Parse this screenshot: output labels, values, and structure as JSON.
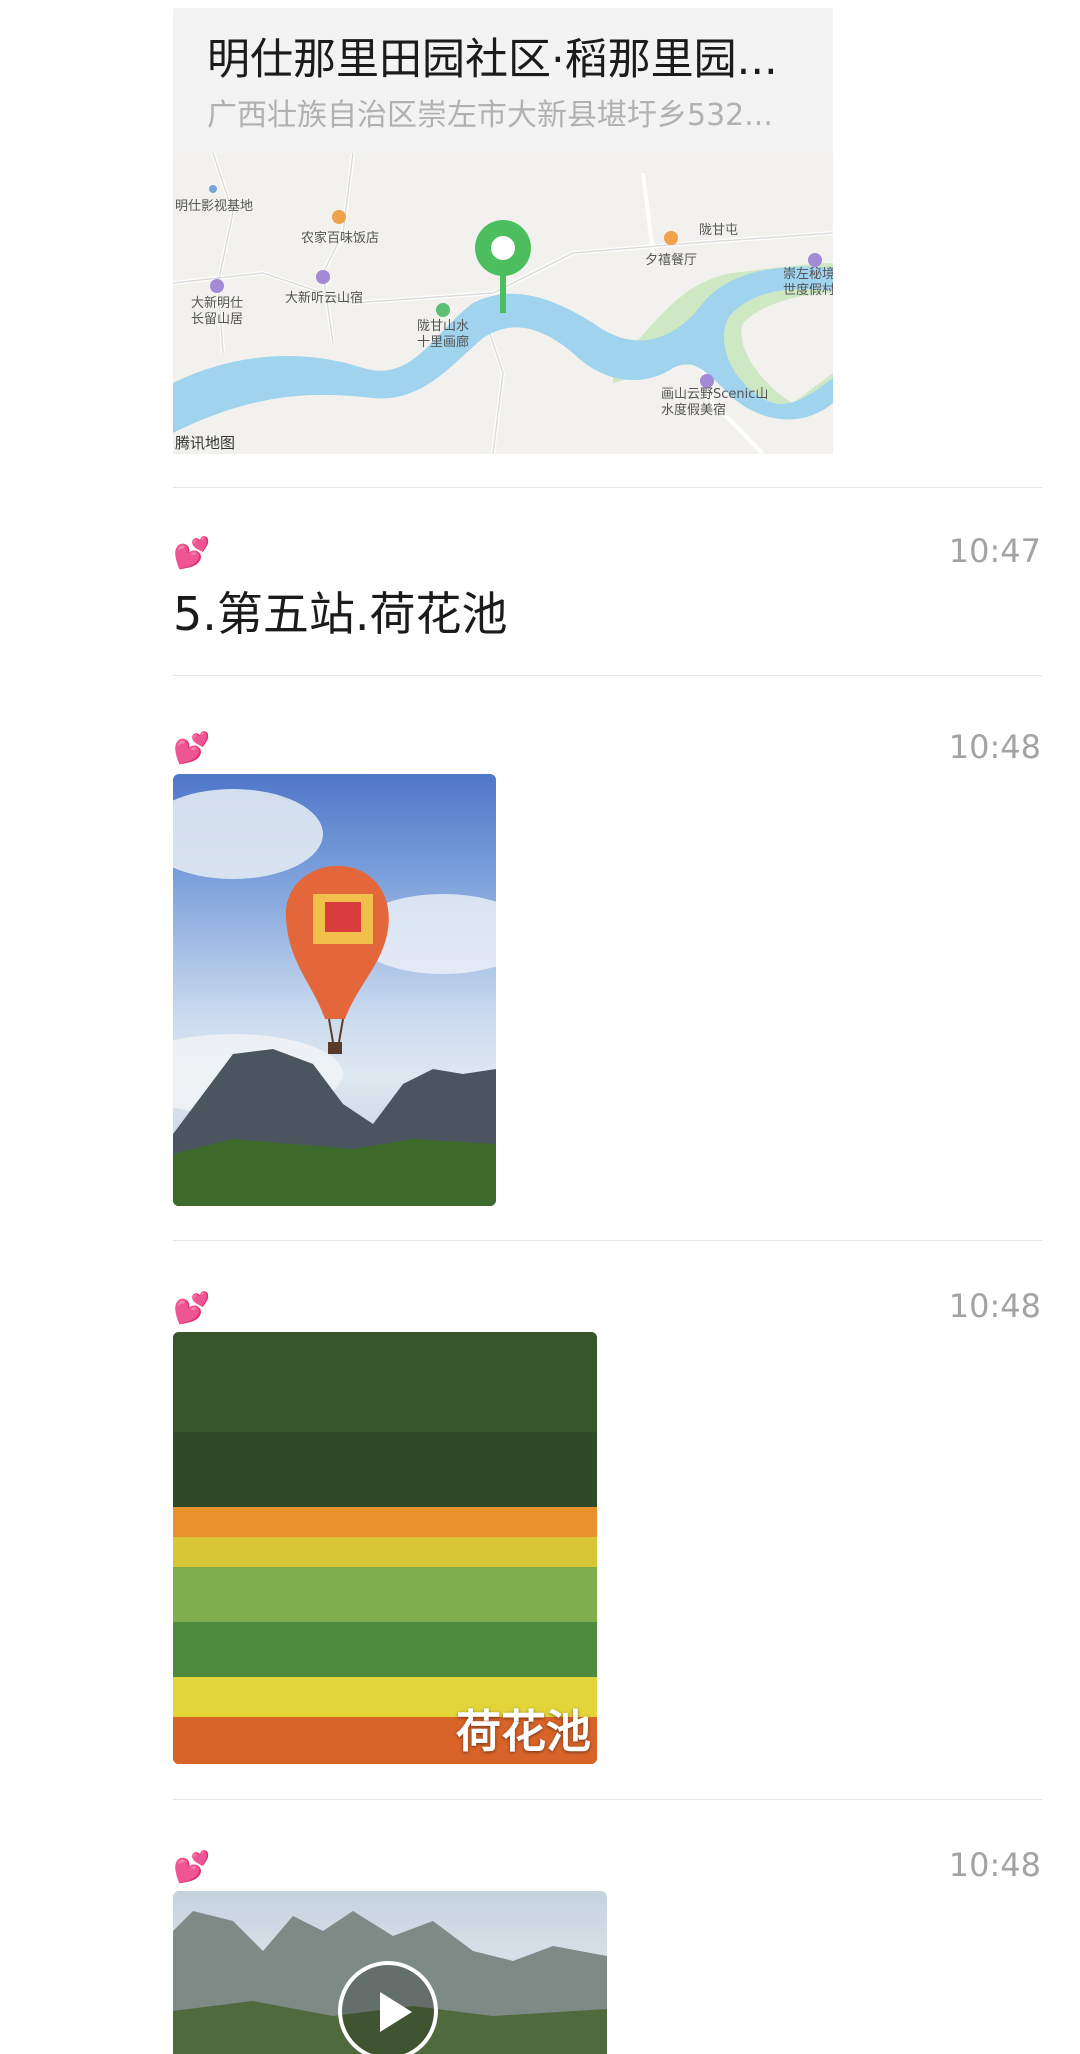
{
  "location": {
    "title": "明仕那里田园社区·稻那里园...",
    "address": "广西壮族自治区崇左市大新县堪圩乡532...",
    "map_labels": {
      "base": "明仕影视基地",
      "restaurant1": "农家百味饭店",
      "inn1": "大新听云山宿",
      "inn2": "大新明仕长留山居",
      "gallery": "陇甘山水十里画廊",
      "village": "陇甘屯",
      "restaurant2": "夕禧餐厅",
      "resort": "崇左秘境世度假村",
      "hotel": "画山云野Scenic山水度假美宿",
      "provider": "腾讯地图"
    }
  },
  "messages": [
    {
      "emoji": "💕",
      "time": "10:47",
      "text": "5.第五站.荷花池"
    },
    {
      "emoji": "💕",
      "time": "10:48",
      "image": "hot-air-balloon"
    },
    {
      "emoji": "💕",
      "time": "10:48",
      "image": "lotus-pond",
      "caption": "荷花池"
    },
    {
      "emoji": "💕",
      "time": "10:48",
      "video": "karst-landscape"
    }
  ],
  "colors": {
    "pin": "#4cbe5e",
    "river": "#9fd3ee",
    "divider": "#e6e6e6",
    "time": "#a3a3a3"
  }
}
